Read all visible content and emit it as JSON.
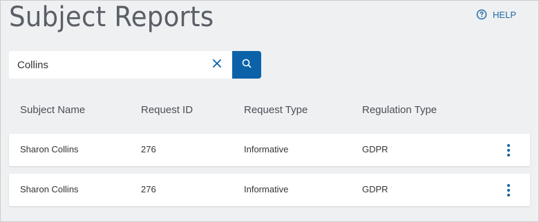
{
  "header": {
    "title": "Subject Reports",
    "help_label": "HELP"
  },
  "search": {
    "value": "Collins",
    "placeholder": ""
  },
  "table": {
    "columns": [
      "Subject Name",
      "Request ID",
      "Request Type",
      "Regulation Type"
    ],
    "rows": [
      {
        "subject_name": "Sharon Collins",
        "request_id": "276",
        "request_type": "Informative",
        "regulation_type": "GDPR"
      },
      {
        "subject_name": "Sharon Collins",
        "request_id": "276",
        "request_type": "Informative",
        "regulation_type": "GDPR"
      }
    ]
  },
  "colors": {
    "accent": "#0b62a8",
    "background": "#eef0f2",
    "row_background": "#ffffff"
  },
  "icons": {
    "help": "question-circle-icon",
    "clear": "close-icon",
    "search": "search-icon",
    "row_menu": "kebab-menu-icon"
  }
}
